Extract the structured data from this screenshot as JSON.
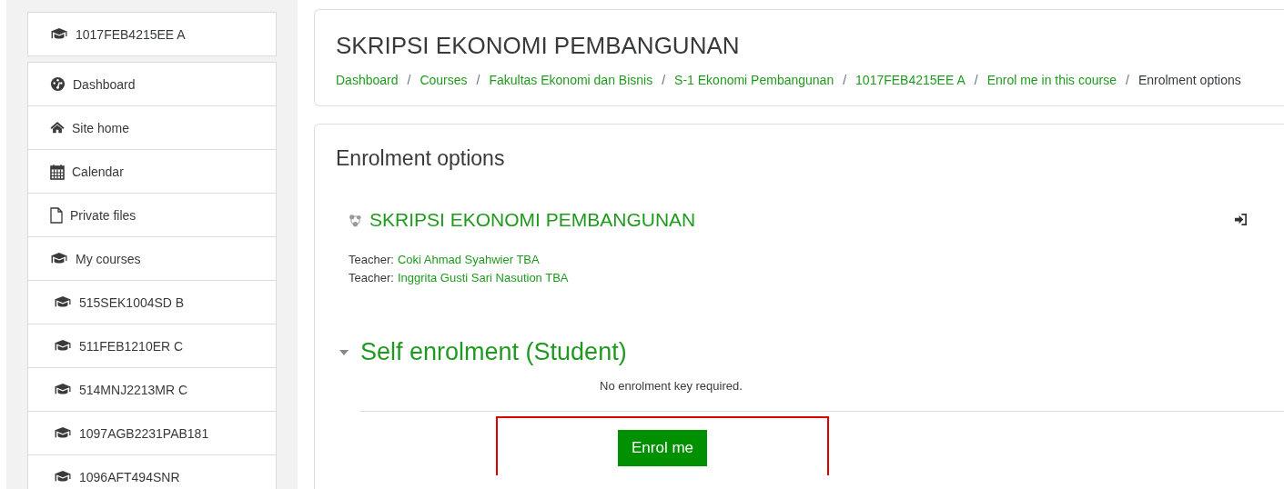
{
  "sidebar": {
    "course_item": {
      "kind": "course",
      "label": "1017FEB4215EE A"
    },
    "items": [
      {
        "kind": "dashboard",
        "label": "Dashboard"
      },
      {
        "kind": "home",
        "label": "Site home"
      },
      {
        "kind": "calendar",
        "label": "Calendar"
      },
      {
        "kind": "file",
        "label": "Private files"
      },
      {
        "kind": "course",
        "label": "My courses",
        "children": [
          {
            "kind": "course",
            "label": "515SEK1004SD B"
          },
          {
            "kind": "course",
            "label": "511FEB1210ER C"
          },
          {
            "kind": "course",
            "label": "514MNJ2213MR C"
          },
          {
            "kind": "course",
            "label": "1097AGB2231PAB181"
          },
          {
            "kind": "course",
            "label": "1096AFT494SNR"
          }
        ]
      }
    ]
  },
  "header": {
    "title": "SKRIPSI EKONOMI PEMBANGUNAN",
    "breadcrumb": [
      {
        "kind": "link",
        "label": "Dashboard"
      },
      {
        "kind": "separator",
        "label": "/"
      },
      {
        "kind": "link",
        "label": "Courses"
      },
      {
        "kind": "separator",
        "label": "/"
      },
      {
        "kind": "link",
        "label": "Fakultas Ekonomi dan Bisnis"
      },
      {
        "kind": "separator",
        "label": "/"
      },
      {
        "kind": "link",
        "label": "S-1 Ekonomi Pembangunan"
      },
      {
        "kind": "separator",
        "label": "/"
      },
      {
        "kind": "link",
        "label": "1017FEB4215EE A"
      },
      {
        "kind": "separator",
        "label": "/"
      },
      {
        "kind": "link",
        "label": "Enrol me in this course"
      },
      {
        "kind": "separator",
        "label": "/"
      },
      {
        "kind": "current",
        "label": "Enrolment options"
      }
    ]
  },
  "enrolment": {
    "heading": "Enrolment options",
    "course": {
      "name": "SKRIPSI EKONOMI PEMBANGUNAN",
      "teachers": [
        {
          "role": "Teacher:",
          "name": "Coki Ahmad Syahwier TBA"
        },
        {
          "role": "Teacher:",
          "name": "Inggrita Gusti Sari Nasution TBA"
        }
      ]
    },
    "method": {
      "title": "Self enrolment (Student)",
      "expanded": true,
      "note": "No enrolment key required.",
      "button": {
        "label": "Enrol me",
        "highlighted": true
      }
    }
  }
}
